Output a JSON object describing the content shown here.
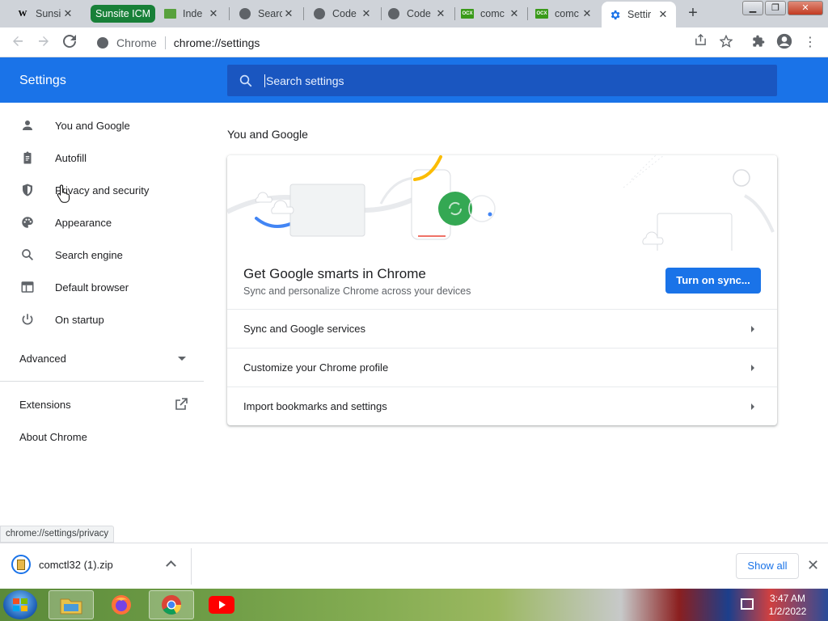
{
  "tabs": [
    {
      "title": "Sunsi",
      "favicon": "wikipedia-icon"
    },
    {
      "title": "Inde",
      "favicon": "doc-icon"
    },
    {
      "title": "Searc",
      "favicon": "globe-icon"
    },
    {
      "title": "Code",
      "favicon": "globe-icon"
    },
    {
      "title": "Code",
      "favicon": "globe-icon"
    },
    {
      "title": "comc",
      "favicon": "ocx-icon"
    },
    {
      "title": "comc",
      "favicon": "ocx-icon"
    },
    {
      "title": "Settir",
      "favicon": "gear-icon"
    }
  ],
  "tab_group": {
    "label": "Sunsite ICM",
    "color": "#188038"
  },
  "ocx_label": "OCX",
  "omnibox": {
    "site_label": "Chrome",
    "url": "chrome://settings"
  },
  "settings": {
    "title": "Settings",
    "search_placeholder": "Search settings"
  },
  "sidebar": {
    "items": [
      {
        "label": "You and Google",
        "icon": "person-icon"
      },
      {
        "label": "Autofill",
        "icon": "clipboard-icon"
      },
      {
        "label": "Privacy and security",
        "icon": "shield-icon"
      },
      {
        "label": "Appearance",
        "icon": "palette-icon"
      },
      {
        "label": "Search engine",
        "icon": "search-icon"
      },
      {
        "label": "Default browser",
        "icon": "browser-icon"
      },
      {
        "label": "On startup",
        "icon": "power-icon"
      }
    ],
    "advanced": "Advanced",
    "extensions": "Extensions",
    "about": "About Chrome"
  },
  "main": {
    "section_title": "You and Google",
    "promo_title": "Get Google smarts in Chrome",
    "promo_subtitle": "Sync and personalize Chrome across your devices",
    "sync_button": "Turn on sync...",
    "rows": [
      "Sync and Google services",
      "Customize your Chrome profile",
      "Import bookmarks and settings"
    ]
  },
  "status_url": "chrome://settings/privacy",
  "downloads": {
    "filename": "comctl32 (1).zip",
    "show_all": "Show all"
  },
  "taskbar": {
    "time": "3:47 AM",
    "date": "1/2/2022"
  },
  "colors": {
    "accent": "#1a73e8",
    "header_search": "#1a56c0"
  }
}
